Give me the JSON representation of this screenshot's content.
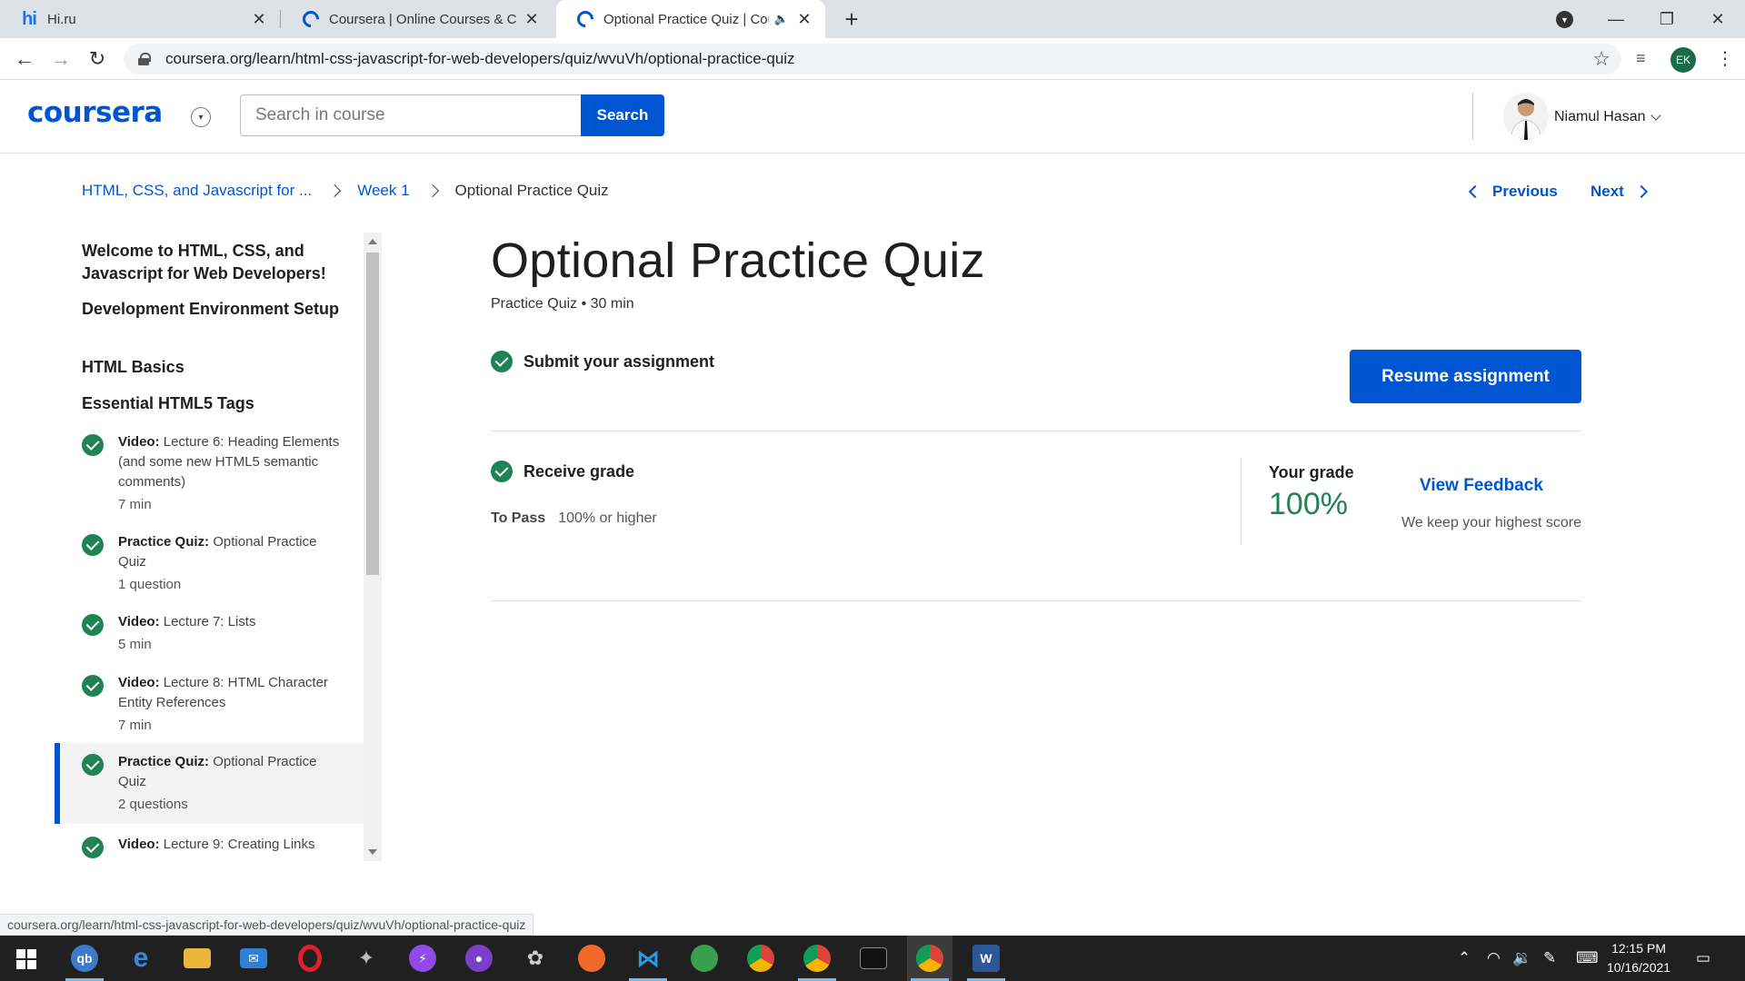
{
  "browser": {
    "tabs": [
      {
        "title": "Hi.ru",
        "favicon": "hi-favicon"
      },
      {
        "title": "Coursera | Online Courses & Credentials",
        "favicon": "coursera-favicon"
      },
      {
        "title": "Optional Practice Quiz | Coursera",
        "favicon": "coursera-favicon"
      }
    ],
    "url": "coursera.org/learn/html-css-javascript-for-web-developers/quiz/wvuVh/optional-practice-quiz",
    "profile_initials": "EK",
    "status_url": "coursera.org/learn/html-css-javascript-for-web-developers/quiz/wvuVh/optional-practice-quiz"
  },
  "header": {
    "logo": "coursera",
    "search_placeholder": "Search in course",
    "search_button": "Search",
    "user_name": "Niamul Hasan"
  },
  "breadcrumb": {
    "course": "HTML, CSS, and Javascript for ...",
    "week": "Week 1",
    "current": "Optional Practice Quiz"
  },
  "nav": {
    "previous": "Previous",
    "next": "Next"
  },
  "sidebar": {
    "sections": [
      "Welcome to HTML, CSS, and Javascript for Web Developers!",
      "Development Environment Setup",
      "HTML Basics",
      "Essential HTML5 Tags"
    ],
    "items": [
      {
        "type": "Video:",
        "title": "Lecture 6: Heading Elements (and some new HTML5 semantic comments)",
        "duration": "7 min"
      },
      {
        "type": "Practice Quiz:",
        "title": "Optional Practice Quiz",
        "duration": "1 question"
      },
      {
        "type": "Video:",
        "title": "Lecture 7: Lists",
        "duration": "5 min"
      },
      {
        "type": "Video:",
        "title": "Lecture 8: HTML Character Entity References",
        "duration": "7 min"
      },
      {
        "type": "Practice Quiz:",
        "title": "Optional Practice Quiz",
        "duration": "2 questions"
      },
      {
        "type": "Video:",
        "title": "Lecture 9: Creating Links",
        "duration": ""
      }
    ]
  },
  "main": {
    "title": "Optional Practice Quiz",
    "meta": "Practice Quiz • 30 min",
    "step1": "Submit your assignment",
    "resume_button": "Resume assignment",
    "step2": "Receive grade",
    "to_pass_label": "To Pass",
    "to_pass_value": "100% or higher",
    "your_grade_label": "Your grade",
    "your_grade_value": "100%",
    "view_feedback": "View Feedback",
    "keep_note": "We keep your highest score"
  },
  "taskbar": {
    "time": "12:15 PM",
    "date": "10/16/2021"
  },
  "colors": {
    "brand_blue": "#0056d2",
    "success_green": "#1f8354"
  }
}
